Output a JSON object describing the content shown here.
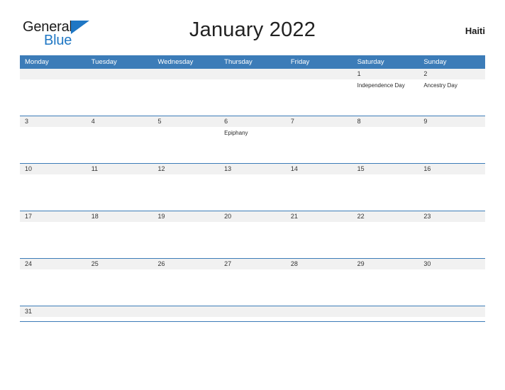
{
  "logo": {
    "part1": "General",
    "part2": "Blue",
    "flag_icon": "flag-triangle-icon",
    "accent_color": "#1f77c4"
  },
  "header": {
    "title": "January 2022",
    "country": "Haiti"
  },
  "colors": {
    "header_blue": "#3c7cb8",
    "row_rule_blue": "#3c7cb8",
    "date_strip_gray": "#f1f1f1",
    "page_background": "#ffffff"
  },
  "calendar": {
    "weekdays": [
      "Monday",
      "Tuesday",
      "Wednesday",
      "Thursday",
      "Friday",
      "Saturday",
      "Sunday"
    ],
    "weeks": [
      [
        {
          "day": "",
          "event": ""
        },
        {
          "day": "",
          "event": ""
        },
        {
          "day": "",
          "event": ""
        },
        {
          "day": "",
          "event": ""
        },
        {
          "day": "",
          "event": ""
        },
        {
          "day": "1",
          "event": "Independence Day"
        },
        {
          "day": "2",
          "event": "Ancestry Day"
        }
      ],
      [
        {
          "day": "3",
          "event": ""
        },
        {
          "day": "4",
          "event": ""
        },
        {
          "day": "5",
          "event": ""
        },
        {
          "day": "6",
          "event": "Epiphany"
        },
        {
          "day": "7",
          "event": ""
        },
        {
          "day": "8",
          "event": ""
        },
        {
          "day": "9",
          "event": ""
        }
      ],
      [
        {
          "day": "10",
          "event": ""
        },
        {
          "day": "11",
          "event": ""
        },
        {
          "day": "12",
          "event": ""
        },
        {
          "day": "13",
          "event": ""
        },
        {
          "day": "14",
          "event": ""
        },
        {
          "day": "15",
          "event": ""
        },
        {
          "day": "16",
          "event": ""
        }
      ],
      [
        {
          "day": "17",
          "event": ""
        },
        {
          "day": "18",
          "event": ""
        },
        {
          "day": "19",
          "event": ""
        },
        {
          "day": "20",
          "event": ""
        },
        {
          "day": "21",
          "event": ""
        },
        {
          "day": "22",
          "event": ""
        },
        {
          "day": "23",
          "event": ""
        }
      ],
      [
        {
          "day": "24",
          "event": ""
        },
        {
          "day": "25",
          "event": ""
        },
        {
          "day": "26",
          "event": ""
        },
        {
          "day": "27",
          "event": ""
        },
        {
          "day": "28",
          "event": ""
        },
        {
          "day": "29",
          "event": ""
        },
        {
          "day": "30",
          "event": ""
        }
      ],
      [
        {
          "day": "31",
          "event": ""
        },
        {
          "day": "",
          "event": ""
        },
        {
          "day": "",
          "event": ""
        },
        {
          "day": "",
          "event": ""
        },
        {
          "day": "",
          "event": ""
        },
        {
          "day": "",
          "event": ""
        },
        {
          "day": "",
          "event": ""
        }
      ]
    ]
  }
}
